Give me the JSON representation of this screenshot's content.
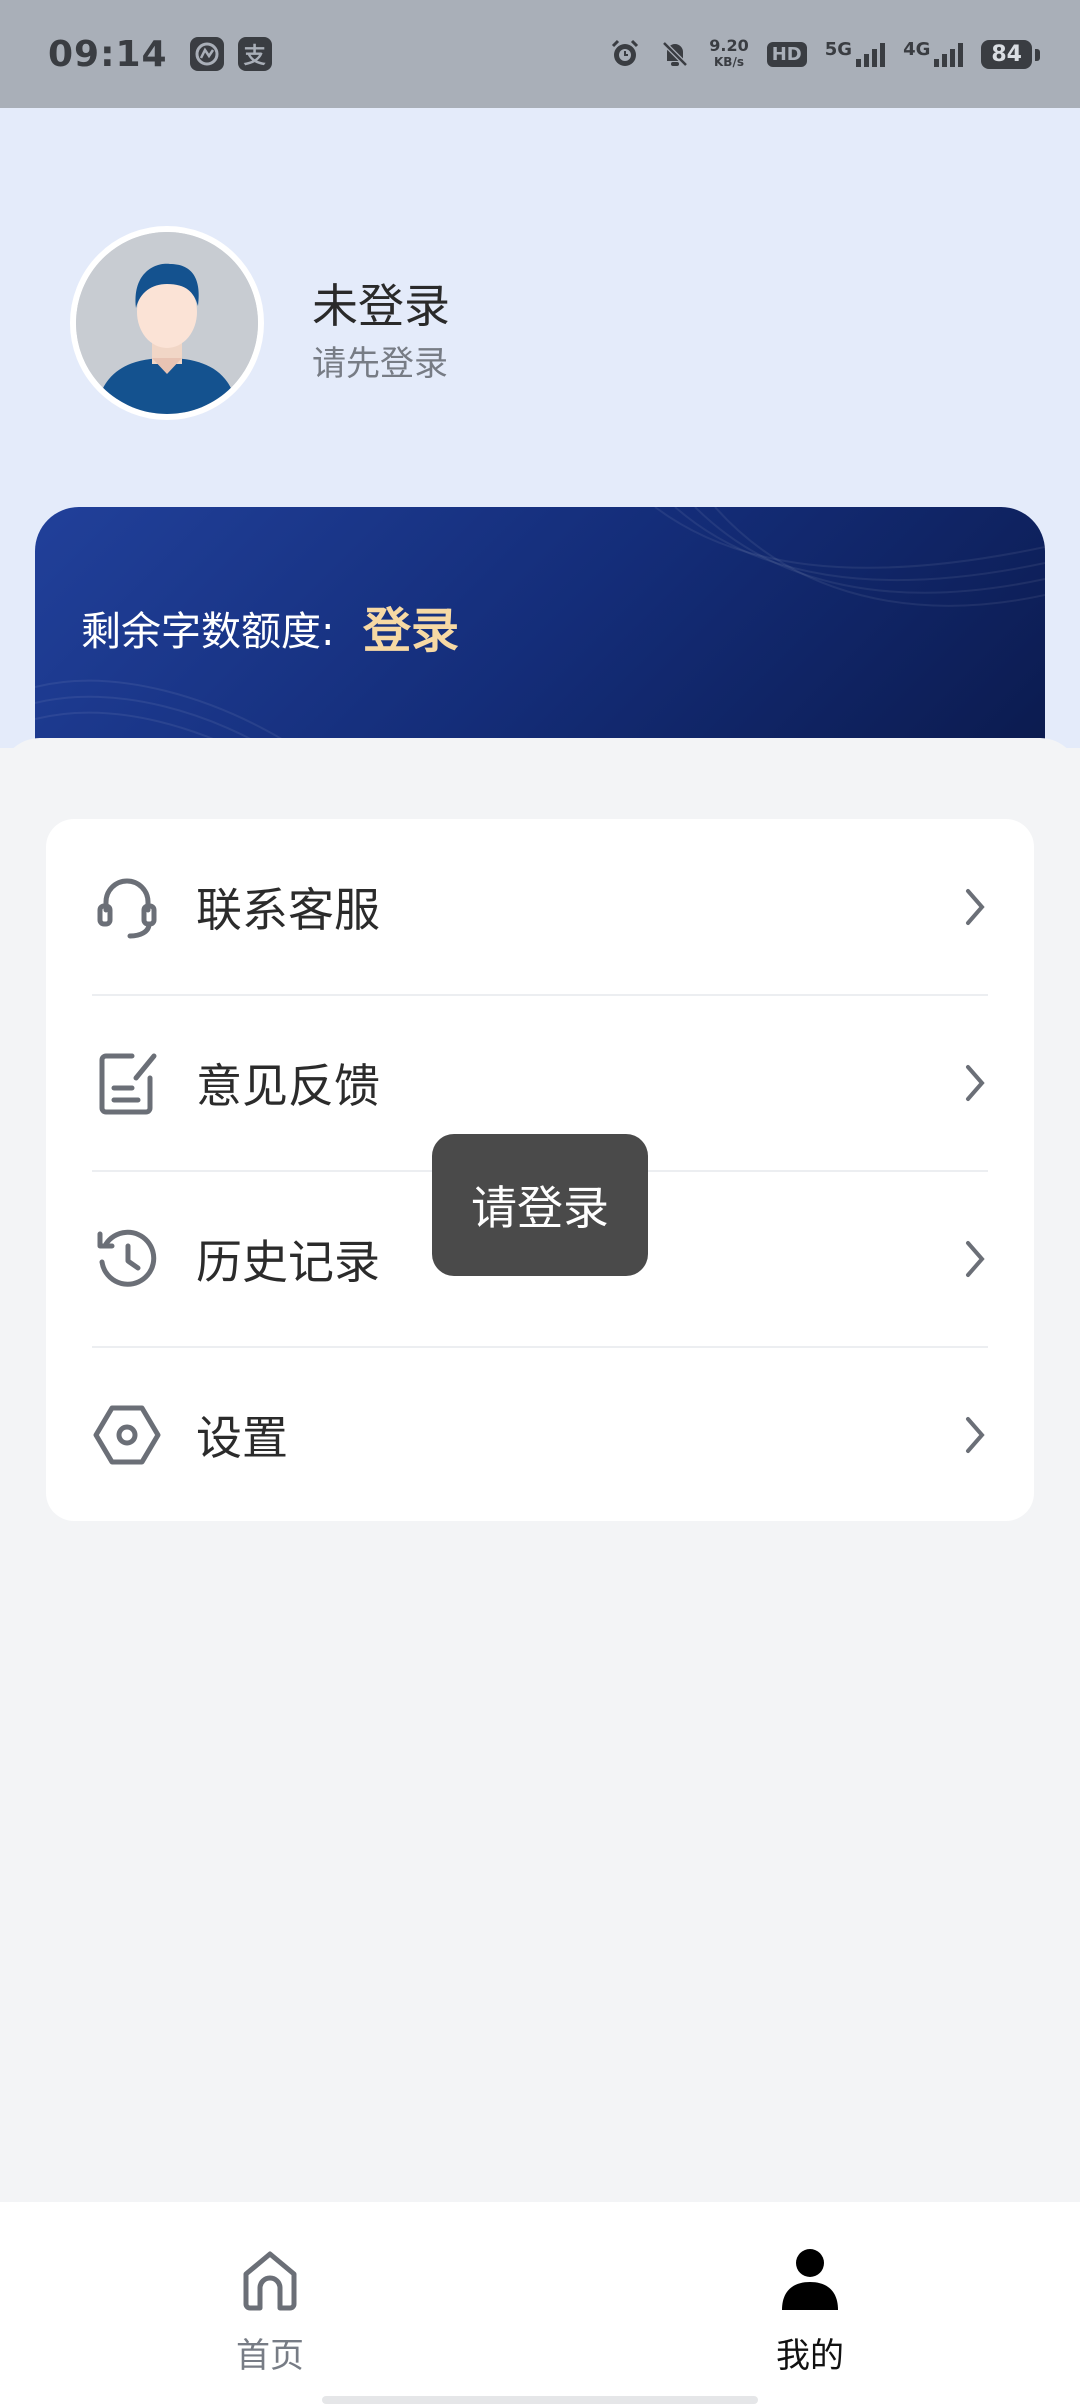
{
  "status_bar": {
    "time": "09:14",
    "app_icons": [
      "ai-app-icon",
      "alipay-icon"
    ],
    "alipay_glyph": "支",
    "net_speed_value": "9.20",
    "net_speed_unit": "KB/s",
    "hd_label": "HD",
    "net_5g": "5G",
    "net_4g": "4G",
    "battery": "84"
  },
  "profile": {
    "name": "未登录",
    "subtitle": "请先登录"
  },
  "quota": {
    "label": "剩余字数额度:",
    "link": "登录"
  },
  "menu": {
    "items": [
      {
        "label": "联系客服",
        "icon": "headset-icon"
      },
      {
        "label": "意见反馈",
        "icon": "feedback-icon"
      },
      {
        "label": "历史记录",
        "icon": "history-icon"
      },
      {
        "label": "设置",
        "icon": "settings-icon"
      }
    ]
  },
  "toast": {
    "text": "请登录"
  },
  "bottom_nav": {
    "items": [
      {
        "label": "首页",
        "icon": "home-icon",
        "active": false
      },
      {
        "label": "我的",
        "icon": "person-icon",
        "active": true
      }
    ]
  },
  "colors": {
    "accent": "#f7d9a4",
    "card_dark": "#142d79",
    "top_bg": "#e4ebfa"
  }
}
